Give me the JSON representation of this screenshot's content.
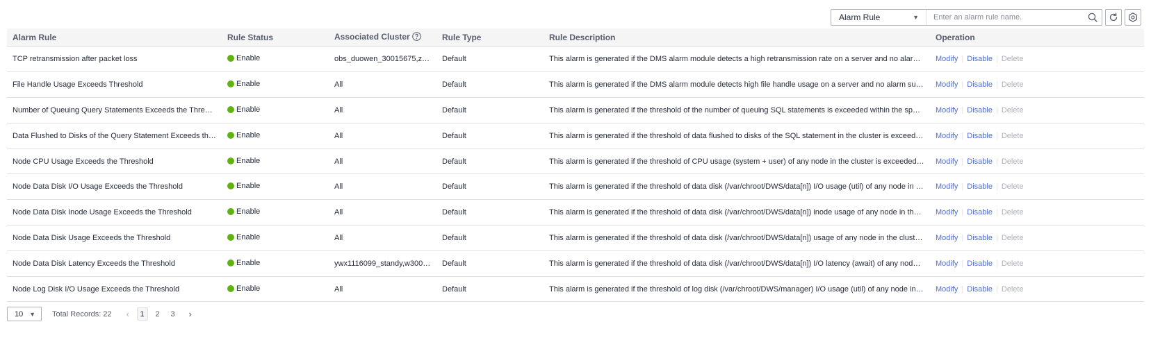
{
  "toolbar": {
    "filter_label": "Alarm Rule",
    "search_placeholder": "Enter an alarm rule name."
  },
  "table": {
    "headers": {
      "alarm_rule": "Alarm Rule",
      "rule_status": "Rule Status",
      "associated_cluster": "Associated Cluster",
      "rule_type": "Rule Type",
      "rule_description": "Rule Description",
      "operation": "Operation"
    },
    "actions": {
      "modify": "Modify",
      "disable": "Disable",
      "delete": "Delete"
    },
    "status_color": "#5fb30f",
    "link_color": "#526ecc",
    "rows": [
      {
        "rule": "TCP retransmission after packet loss",
        "status": "Enable",
        "cluster": "obs_duowen_30015675,z3...",
        "type": "Default",
        "description": "This alarm is generated if the DMS alarm module detects a high retransmission rate on a server and no alarm suppre..."
      },
      {
        "rule": "File Handle Usage Exceeds Threshold",
        "status": "Enable",
        "cluster": "All",
        "type": "Default",
        "description": "This alarm is generated if the DMS alarm module detects high file handle usage on a server and no alarm suppressio..."
      },
      {
        "rule": "Number of Queuing Query Statements Exceeds the Threshold",
        "status": "Enable",
        "cluster": "All",
        "type": "Default",
        "description": "This alarm is generated if the threshold of the number of queuing SQL statements is exceeded within the specified p..."
      },
      {
        "rule": "Data Flushed to Disks of the Query Statement Exceeds the T...",
        "status": "Enable",
        "cluster": "All",
        "type": "Default",
        "description": "This alarm is generated if the threshold of data flushed to disks of the SQL statement in the cluster is exceeded withi..."
      },
      {
        "rule": "Node CPU Usage Exceeds the Threshold",
        "status": "Enable",
        "cluster": "All",
        "type": "Default",
        "description": "This alarm is generated if the threshold of CPU usage (system + user) of any node in the cluster is exceeded within t..."
      },
      {
        "rule": "Node Data Disk I/O Usage Exceeds the Threshold",
        "status": "Enable",
        "cluster": "All",
        "type": "Default",
        "description": "This alarm is generated if the threshold of data disk (/var/chroot/DWS/data[n]) I/O usage (util) of any node in the clust..."
      },
      {
        "rule": "Node Data Disk Inode Usage Exceeds the Threshold",
        "status": "Enable",
        "cluster": "All",
        "type": "Default",
        "description": "This alarm is generated if the threshold of data disk (/var/chroot/DWS/data[n]) inode usage of any node in the cluster ..."
      },
      {
        "rule": "Node Data Disk Usage Exceeds the Threshold",
        "status": "Enable",
        "cluster": "All",
        "type": "Default",
        "description": "This alarm is generated if the threshold of data disk (/var/chroot/DWS/data[n]) usage of any node in the cluster is exc..."
      },
      {
        "rule": "Node Data Disk Latency Exceeds the Threshold",
        "status": "Enable",
        "cluster": "ywx1116099_standy,w3000...",
        "type": "Default",
        "description": "This alarm is generated if the threshold of data disk (/var/chroot/DWS/data[n]) I/O latency (await) of any node in the c..."
      },
      {
        "rule": "Node Log Disk I/O Usage Exceeds the Threshold",
        "status": "Enable",
        "cluster": "All",
        "type": "Default",
        "description": "This alarm is generated if the threshold of log disk (/var/chroot/DWS/manager) I/O usage (util) of any node in the clus..."
      }
    ]
  },
  "pagination": {
    "page_size": "10",
    "total_label": "Total Records: 22",
    "pages": [
      "1",
      "2",
      "3"
    ],
    "current_page": "1",
    "prev_icon": "chevron-left-icon",
    "next_icon": "chevron-right-icon"
  }
}
